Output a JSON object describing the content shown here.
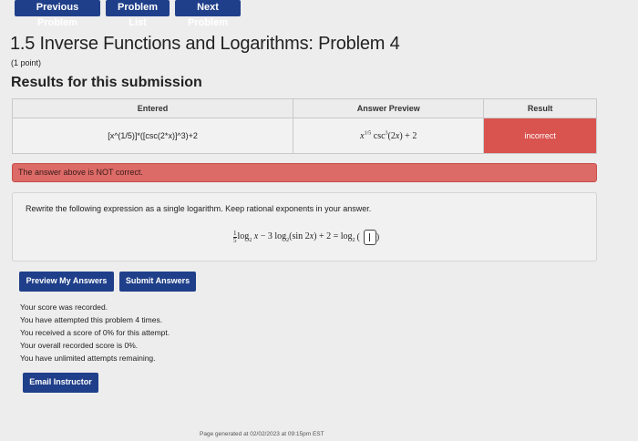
{
  "nav": {
    "previous": "Previous Problem",
    "list": "Problem List",
    "next": "Next Problem"
  },
  "header": {
    "title": "1.5 Inverse Functions and Logarithms: Problem 4",
    "points": "(1 point)"
  },
  "results": {
    "heading": "Results for this submission",
    "columns": [
      "Entered",
      "Answer Preview",
      "Result"
    ],
    "rows": [
      {
        "entered": "[x^(1/5)]*([csc(2*x)]^3)+2",
        "preview_text": "x^(1/5) csc^3(2x) + 2",
        "result": "incorrect"
      }
    ]
  },
  "alert": {
    "text": "The answer above is NOT correct."
  },
  "problem": {
    "instruction": "Rewrite the following expression as a single logarithm. Keep rational exponents in your answer."
  },
  "buttons": {
    "preview": "Preview My Answers",
    "submit": "Submit Answers",
    "email": "Email Instructor"
  },
  "messages": [
    "Your score was recorded.",
    "You have attempted this problem 4 times.",
    "You received a score of 0% for this attempt.",
    "Your overall recorded score is 0%.",
    "You have unlimited attempts remaining."
  ],
  "footer": {
    "text": "Page generated at 02/02/2023 at 09:15pm EST"
  },
  "colors": {
    "primary": "#1f3f8a",
    "incorrect": "#d9534f",
    "alert_bg": "#dc6b67",
    "page_bg": "#ededed"
  }
}
